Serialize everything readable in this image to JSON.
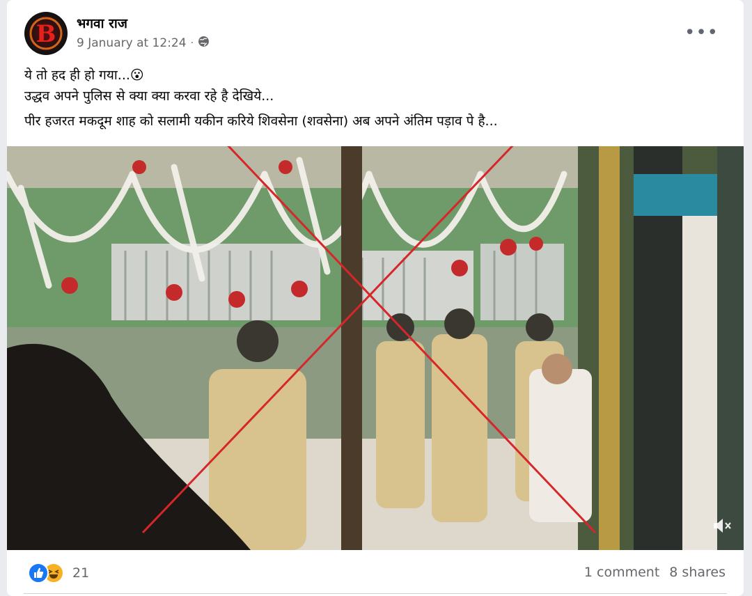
{
  "post": {
    "author": "भगवा राज",
    "timestamp": "9 January at 12:24",
    "separator": "·",
    "more_label": "•••",
    "text_lines": [
      "ये तो हद ही हो गया...😮",
      "उद्धव अपने पुलिस से क्या क्या करवा रहे है देखिये...",
      "पीर हजरत मकदूम शाह को सलामी यकीन करिये शिवसेना (शवसेना) अब अपने अंतिम पड़ाव पे है..."
    ],
    "avatar_letter": "B"
  },
  "icons": {
    "privacy": "globe-icon",
    "mute": "speaker-muted-icon",
    "like": "like-reaction-icon",
    "haha": "haha-reaction-icon"
  },
  "stats": {
    "reaction_count": "21",
    "comments": "1 comment",
    "shares": "8 shares"
  },
  "colors": {
    "cross_overlay": "#d6262a",
    "like_blue": "#1877f2",
    "haha_yellow": "#f7b125"
  }
}
